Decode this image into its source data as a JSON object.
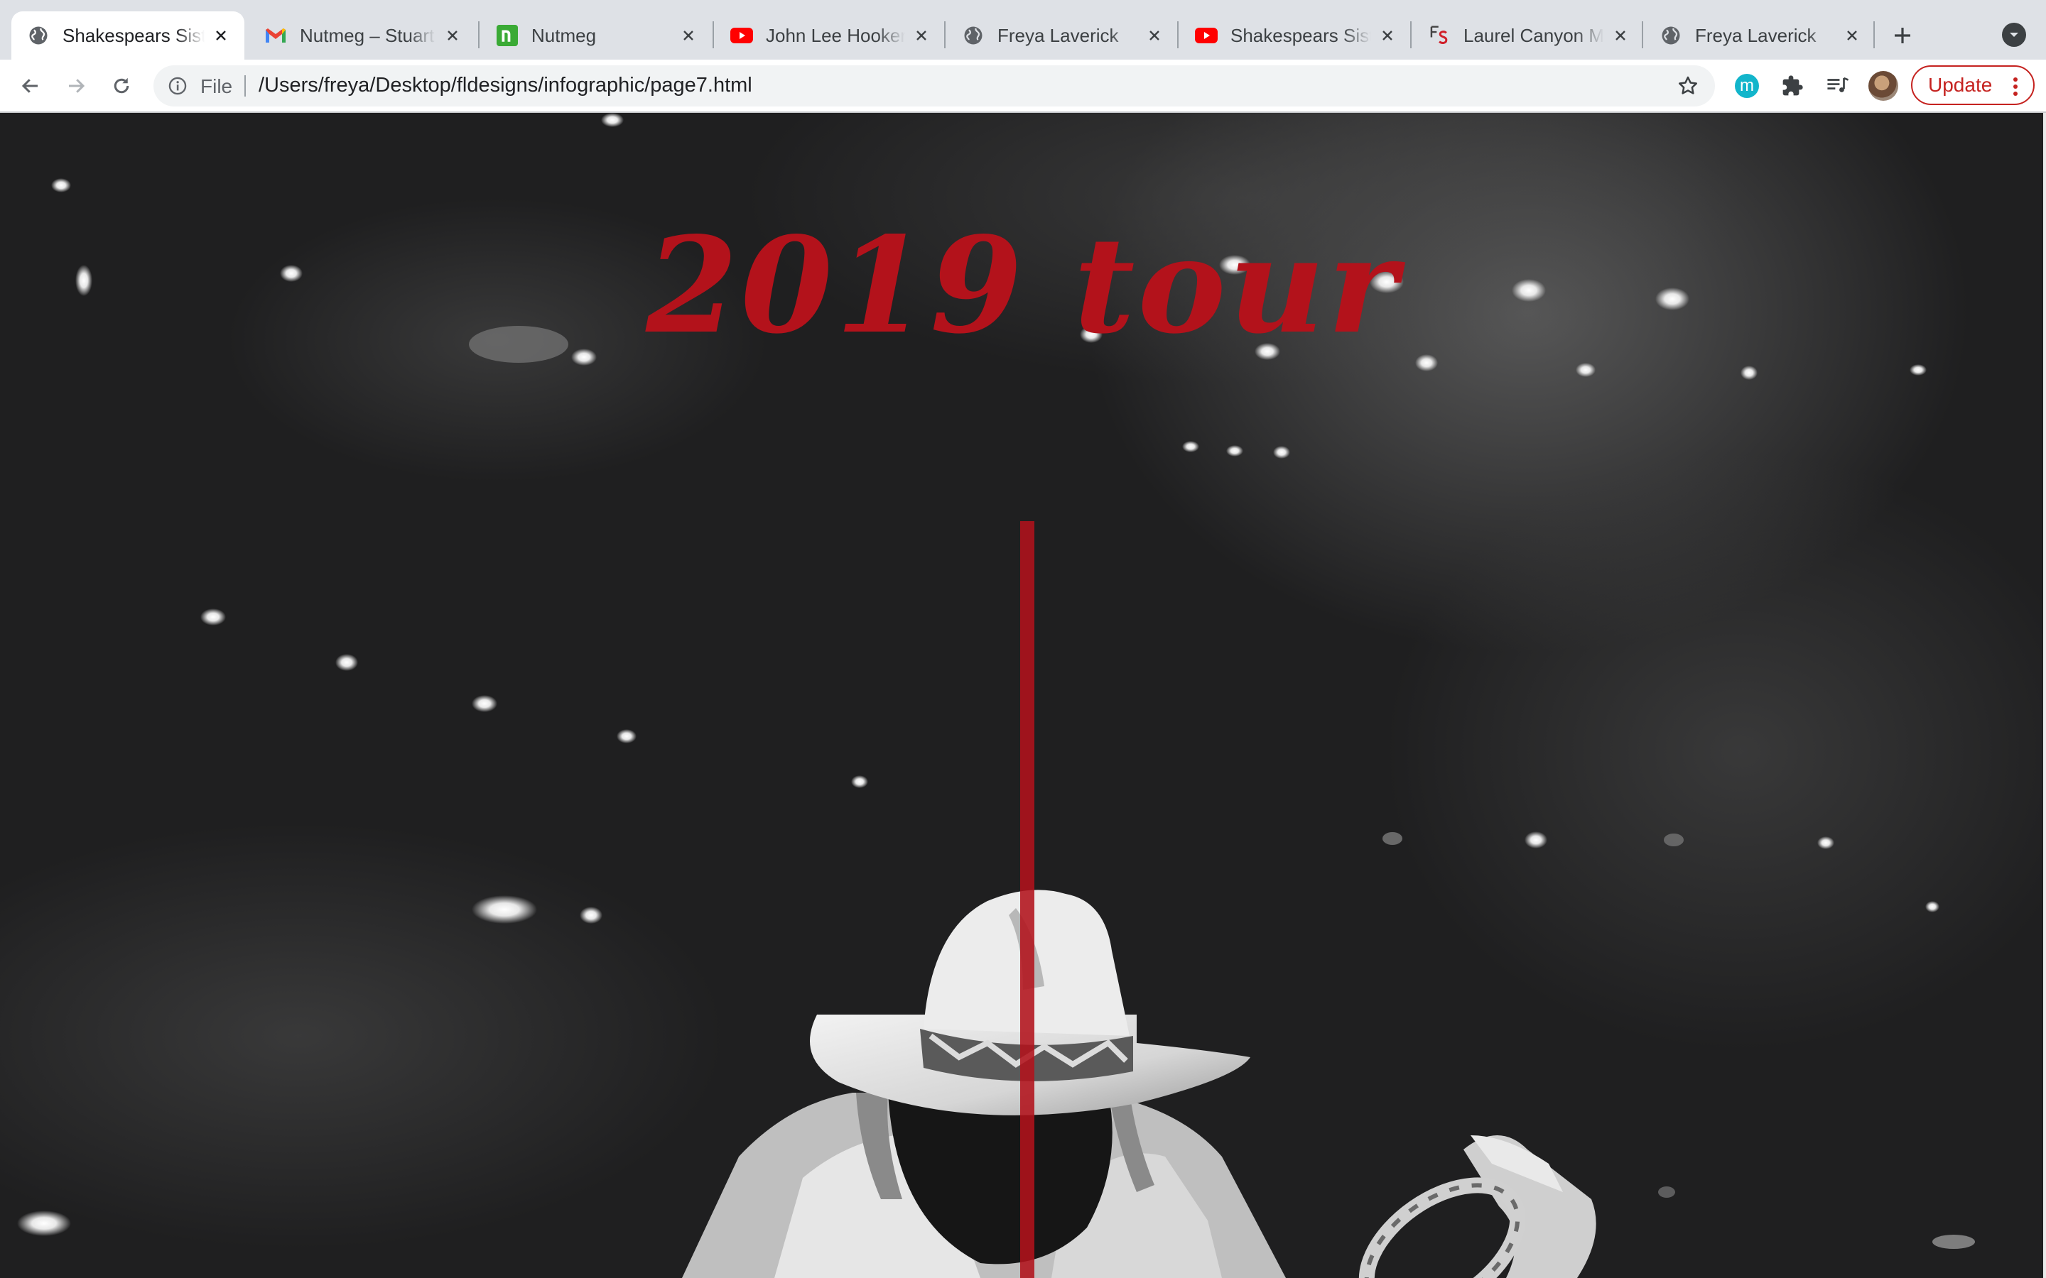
{
  "browser": {
    "tabs": [
      {
        "title": "Shakespears Sister",
        "favicon": "globe-icon",
        "active": true
      },
      {
        "title": "Nutmeg – Stuart mail",
        "favicon": "gmail-icon",
        "active": false
      },
      {
        "title": "Nutmeg",
        "favicon": "nutmeg-icon",
        "active": false
      },
      {
        "title": "John Lee Hooker",
        "favicon": "youtube-icon",
        "active": false
      },
      {
        "title": "Freya Laverick",
        "favicon": "globe-icon",
        "active": false
      },
      {
        "title": "Shakespears Sister",
        "favicon": "youtube-icon",
        "active": false
      },
      {
        "title": "Laurel Canyon Maps",
        "favicon": "fs-logo-icon",
        "active": false
      },
      {
        "title": "Freya Laverick",
        "favicon": "globe-icon",
        "active": false
      }
    ],
    "omnibox": {
      "scheme_label": "File",
      "url": "/Users/freya/Desktop/fldesigns/infographic/page7.html"
    },
    "extension_label": "m",
    "update_label": "Update"
  },
  "page": {
    "title": "2019 tour",
    "colors": {
      "accent": "#b3121b",
      "background": "#1e1e1f"
    }
  }
}
